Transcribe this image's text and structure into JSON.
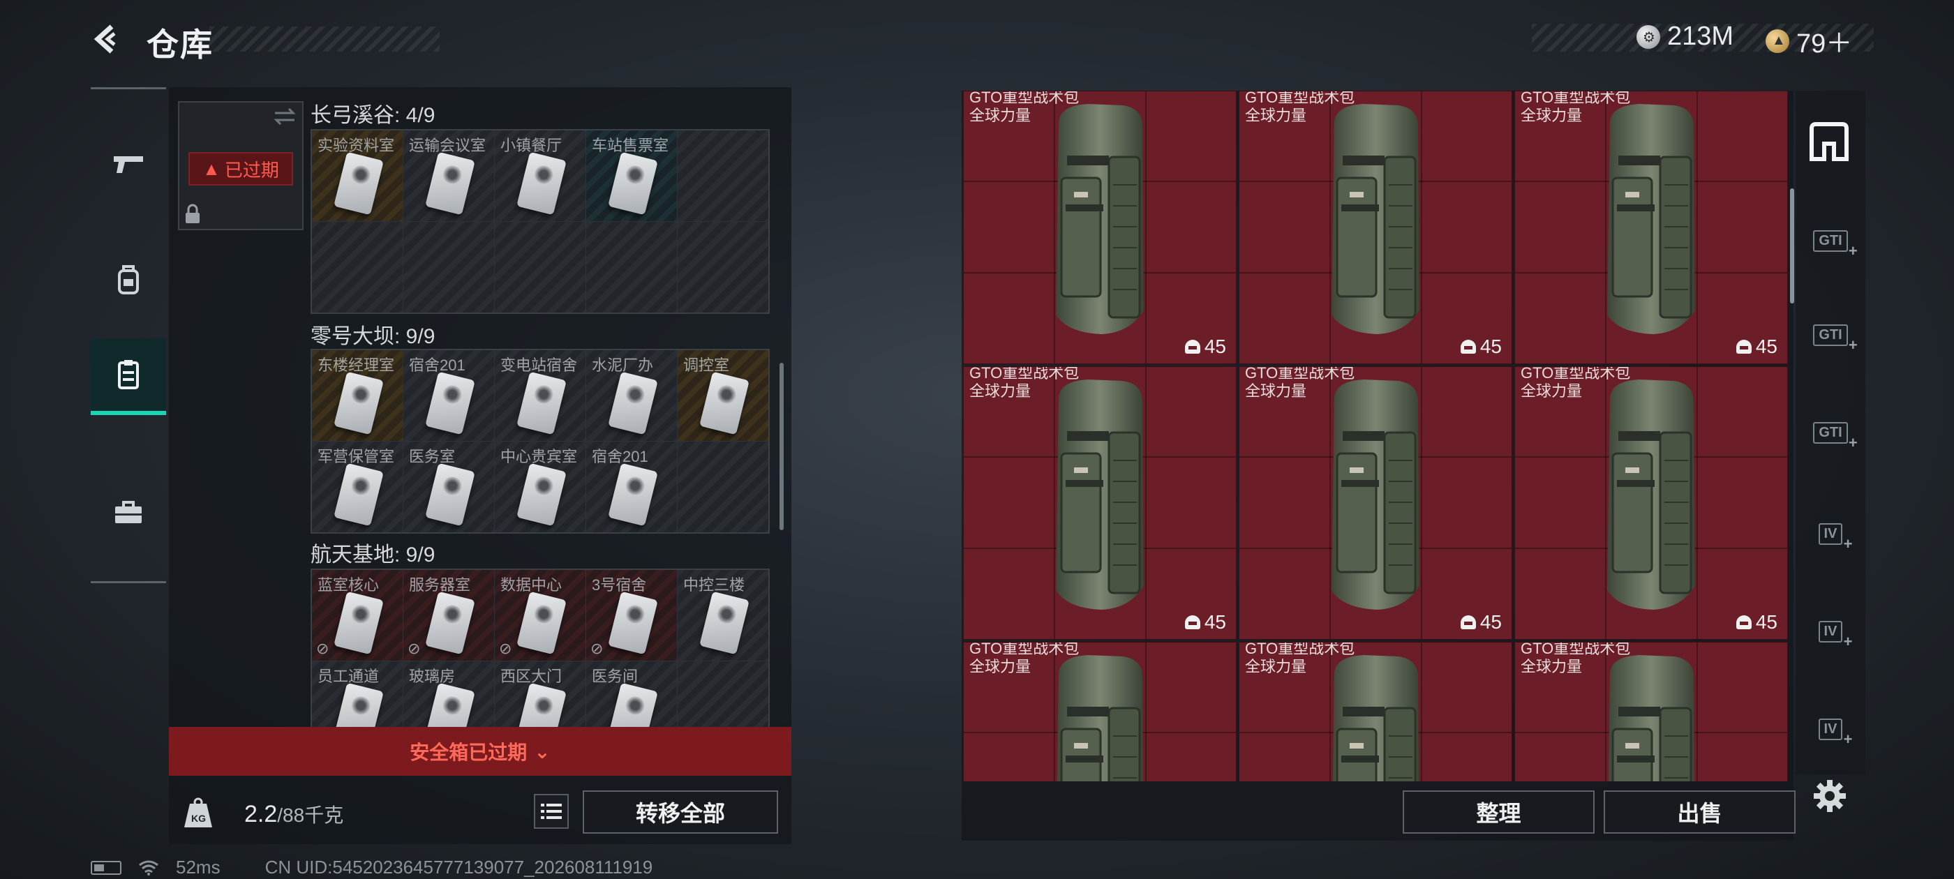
{
  "header": {
    "title": "仓库",
    "currency": [
      {
        "icon": "silver-coin-icon",
        "value": "213M"
      },
      {
        "icon": "gold-coin-icon",
        "value": "79＋"
      }
    ]
  },
  "rail": {
    "items": [
      {
        "name": "weapons",
        "icon": "pistol-icon",
        "active": false
      },
      {
        "name": "equipment",
        "icon": "backpack-icon",
        "active": false
      },
      {
        "name": "keys",
        "icon": "clipboard-icon",
        "active": true
      },
      {
        "name": "tools",
        "icon": "briefcase-icon",
        "active": false
      }
    ]
  },
  "safe_box": {
    "status": "已过期",
    "banner": "安全箱已过期"
  },
  "sections": [
    {
      "title": "长弓溪谷: 4/9",
      "cells": [
        {
          "label": "实验资料室",
          "style": "gold",
          "has_key": true
        },
        {
          "label": "运输会议室",
          "style": "grey",
          "has_key": true
        },
        {
          "label": "小镇餐厅",
          "style": "grey",
          "has_key": true
        },
        {
          "label": "车站售票室",
          "style": "teal",
          "has_key": true
        },
        {
          "label": "",
          "style": "grey",
          "has_key": false
        },
        {
          "label": "",
          "style": "grey",
          "has_key": false
        },
        {
          "label": "",
          "style": "grey",
          "has_key": false
        },
        {
          "label": "",
          "style": "grey",
          "has_key": false
        },
        {
          "label": "",
          "style": "grey",
          "has_key": false
        },
        {
          "label": "",
          "style": "grey",
          "has_key": false
        }
      ]
    },
    {
      "title": "零号大坝: 9/9",
      "cells": [
        {
          "label": "东楼经理室",
          "style": "gold",
          "has_key": true
        },
        {
          "label": "宿舍201",
          "style": "grey",
          "has_key": true
        },
        {
          "label": "变电站宿舍",
          "style": "grey",
          "has_key": true
        },
        {
          "label": "水泥厂办",
          "style": "grey",
          "has_key": true
        },
        {
          "label": "调控室",
          "style": "gold",
          "has_key": true
        },
        {
          "label": "军营保管室",
          "style": "grey",
          "has_key": true
        },
        {
          "label": "医务室",
          "style": "grey",
          "has_key": true
        },
        {
          "label": "中心贵宾室",
          "style": "grey",
          "has_key": true
        },
        {
          "label": "宿舍201",
          "style": "grey",
          "has_key": true
        },
        {
          "label": "",
          "style": "grey",
          "has_key": false
        }
      ]
    },
    {
      "title": "航天基地: 9/9",
      "cells": [
        {
          "label": "蓝室核心",
          "style": "red",
          "has_key": true
        },
        {
          "label": "服务器室",
          "style": "red",
          "has_key": true
        },
        {
          "label": "数据中心",
          "style": "red",
          "has_key": true
        },
        {
          "label": "3号宿舍",
          "style": "red",
          "has_key": true
        },
        {
          "label": "中控三楼",
          "style": "grey",
          "has_key": true
        },
        {
          "label": "员工通道",
          "style": "grey",
          "has_key": true
        },
        {
          "label": "玻璃房",
          "style": "grey",
          "has_key": true
        },
        {
          "label": "西区大门",
          "style": "grey",
          "has_key": true
        },
        {
          "label": "医务间",
          "style": "grey",
          "has_key": true
        },
        {
          "label": "",
          "style": "grey",
          "has_key": false
        }
      ]
    }
  ],
  "weight": {
    "current": "2.2",
    "capacity": "/88千克"
  },
  "buttons": {
    "transfer_all": "转移全部",
    "sort": "整理",
    "sell": "出售"
  },
  "stash": {
    "items": [
      {
        "name": "GTO重型战术包",
        "subtitle": "全球力量",
        "durability": "45"
      },
      {
        "name": "GTO重型战术包",
        "subtitle": "全球力量",
        "durability": "45"
      },
      {
        "name": "GTO重型战术包",
        "subtitle": "全球力量",
        "durability": "45"
      },
      {
        "name": "GTO重型战术包",
        "subtitle": "全球力量",
        "durability": "45"
      },
      {
        "name": "GTO重型战术包",
        "subtitle": "全球力量",
        "durability": "45"
      },
      {
        "name": "GTO重型战术包",
        "subtitle": "全球力量",
        "durability": "45"
      },
      {
        "name": "GTO重型战术包",
        "subtitle": "全球力量",
        "durability": ""
      },
      {
        "name": "GTO重型战术包",
        "subtitle": "全球力量",
        "durability": ""
      },
      {
        "name": "GTO重型战术包",
        "subtitle": "全球力量",
        "durability": ""
      }
    ]
  },
  "tool_rail": {
    "labels": [
      "GTI",
      "GTI",
      "GTI",
      "IV",
      "IV",
      "IV"
    ]
  },
  "status_bar": {
    "ping": "52ms",
    "uid": "CN UID:5452023645777139077_202608111919"
  },
  "colors": {
    "accent": "#19d6b4",
    "danger": "#ff5a4d",
    "item_bg_red": "#6b1e27"
  }
}
